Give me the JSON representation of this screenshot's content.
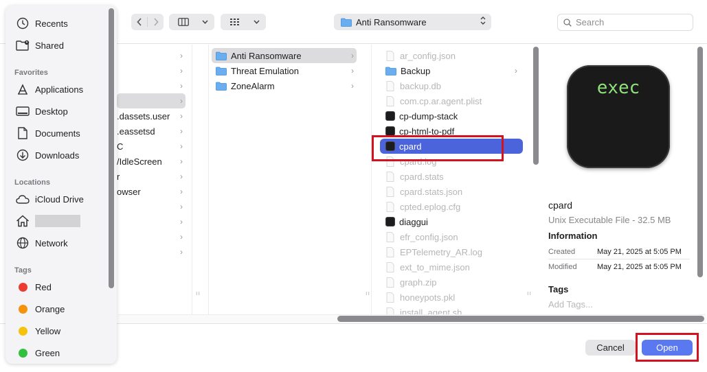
{
  "toolbar": {
    "back_icon": "chevron-left-icon",
    "forward_icon": "chevron-right-icon",
    "view_mode_icon": "column-view-icon",
    "group_icon": "grid-view-icon",
    "location": "Anti Ransomware",
    "search_placeholder": "Search"
  },
  "sidebar": {
    "recents": "Recents",
    "shared": "Shared",
    "favorites_header": "Favorites",
    "applications": "Applications",
    "desktop": "Desktop",
    "documents": "Documents",
    "downloads": "Downloads",
    "locations_header": "Locations",
    "icloud": "iCloud Drive",
    "network": "Network",
    "tags_header": "Tags",
    "tags": [
      {
        "name": "Red",
        "color": "#ec3b32"
      },
      {
        "name": "Orange",
        "color": "#f5920e"
      },
      {
        "name": "Yellow",
        "color": "#f5c30e"
      },
      {
        "name": "Green",
        "color": "#34c03f"
      }
    ]
  },
  "column1": {
    "items": [
      ".dassets.user",
      ".eassetsd",
      "C",
      "/IdleScreen",
      "r",
      "owser"
    ]
  },
  "column2": {
    "items": [
      "Anti Ransomware",
      "Threat Emulation",
      "ZoneAlarm"
    ]
  },
  "column3": {
    "items": [
      {
        "name": "ar_config.json",
        "kind": "doc",
        "dim": true
      },
      {
        "name": "Backup",
        "kind": "folder",
        "dim": false
      },
      {
        "name": "backup.db",
        "kind": "doc",
        "dim": true
      },
      {
        "name": "com.cp.ar.agent.plist",
        "kind": "doc",
        "dim": true
      },
      {
        "name": "cp-dump-stack",
        "kind": "exec",
        "dim": false
      },
      {
        "name": "cp-html-to-pdf",
        "kind": "exec",
        "dim": false
      },
      {
        "name": "cpard",
        "kind": "exec",
        "dim": false
      },
      {
        "name": "cpard.log",
        "kind": "doc",
        "dim": true
      },
      {
        "name": "cpard.stats",
        "kind": "doc",
        "dim": true
      },
      {
        "name": "cpard.stats.json",
        "kind": "doc",
        "dim": true
      },
      {
        "name": "cpted.eplog.cfg",
        "kind": "doc",
        "dim": true
      },
      {
        "name": "diaggui",
        "kind": "exec",
        "dim": false
      },
      {
        "name": "efr_config.json",
        "kind": "doc",
        "dim": true
      },
      {
        "name": "EPTelemetry_AR.log",
        "kind": "doc",
        "dim": true
      },
      {
        "name": "ext_to_mime.json",
        "kind": "doc",
        "dim": true
      },
      {
        "name": "graph.zip",
        "kind": "doc",
        "dim": true
      },
      {
        "name": "honeypots.pkl",
        "kind": "doc",
        "dim": true
      },
      {
        "name": "install_agent.sh",
        "kind": "doc",
        "dim": true
      }
    ]
  },
  "preview": {
    "icon_text": "exec",
    "name": "cpard",
    "kind": "Unix Executable File - 32.5 MB",
    "info_header": "Information",
    "created_label": "Created",
    "created_value": "May 21, 2025 at 5:05 PM",
    "modified_label": "Modified",
    "modified_value": "May 21, 2025 at 5:05 PM",
    "tags_header": "Tags",
    "tags_placeholder": "Add Tags..."
  },
  "buttons": {
    "cancel": "Cancel",
    "open": "Open"
  },
  "colors": {
    "accent": "#4b64dc",
    "annotation": "#d4111f"
  }
}
